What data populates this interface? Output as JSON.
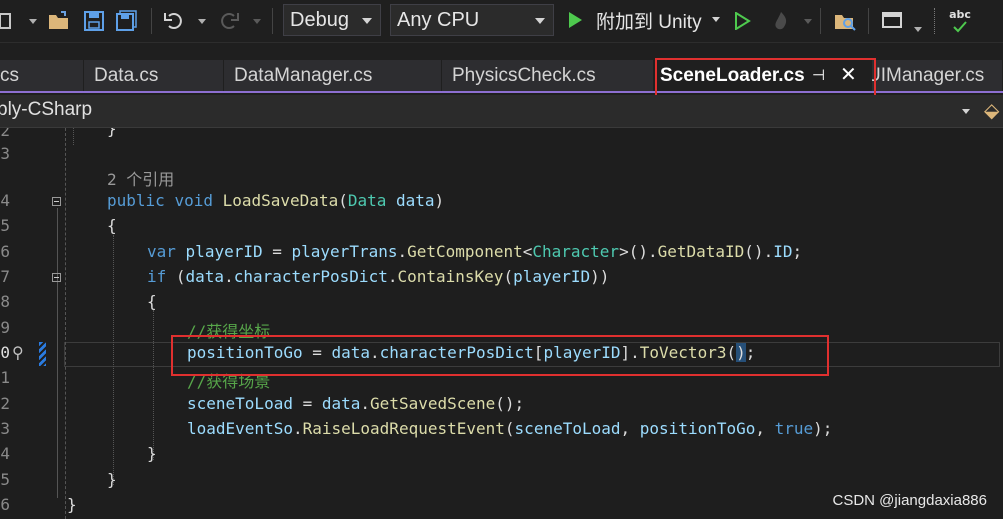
{
  "toolbar": {
    "config_value": "Debug",
    "platform_value": "Any CPU",
    "attach_label": "附加到 Unity",
    "spell_label": "abc"
  },
  "tabs": [
    {
      "label": "cs",
      "active": false
    },
    {
      "label": "Data.cs",
      "active": false
    },
    {
      "label": "DataManager.cs",
      "active": false
    },
    {
      "label": "PhysicsCheck.cs",
      "active": false
    },
    {
      "label": "SceneLoader.cs",
      "active": true
    },
    {
      "label": "UIManager.cs",
      "active": false
    }
  ],
  "navbar": {
    "project": "bly-CSharp"
  },
  "editor": {
    "line_numbers": [
      "2",
      "3",
      "4",
      "5",
      "6",
      "7",
      "8",
      "9",
      "0",
      "1",
      "2",
      "3",
      "4",
      "5",
      "6"
    ],
    "ref_count": "2 个引用",
    "comment_get_pos": "//获得坐标",
    "comment_get_scene": "//获得场景"
  },
  "watermark": "CSDN @jiangdaxia886",
  "colors": {
    "accent": "#8d6fd1",
    "highlight_box": "#e0302f",
    "run_green": "#4ec94e"
  }
}
